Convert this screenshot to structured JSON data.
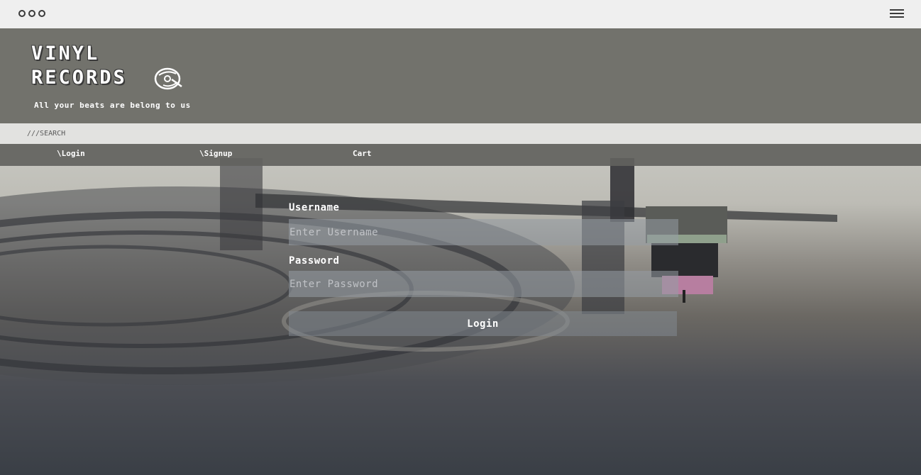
{
  "window": {
    "icons": [
      "three-dots-icon",
      "hamburger-menu-icon"
    ]
  },
  "header": {
    "logo_line1": "VINYL",
    "logo_line2": "RECORDS",
    "logo_icon": "record-icon",
    "tagline": "All your beats are belong to us"
  },
  "search": {
    "placeholder": "///SEARCH"
  },
  "nav": {
    "login": "\\Login",
    "signup": "\\Signup",
    "cart": "Cart"
  },
  "form": {
    "username_label": "Username",
    "username_placeholder": "Enter Username",
    "password_label": "Password",
    "password_placeholder": "Enter Password",
    "login_button": "Login"
  },
  "colors": {
    "header_bg": "#72726c",
    "nav_bg": "#62625e",
    "search_bg": "#e2e2e0",
    "chrome_bg": "#efefef"
  }
}
